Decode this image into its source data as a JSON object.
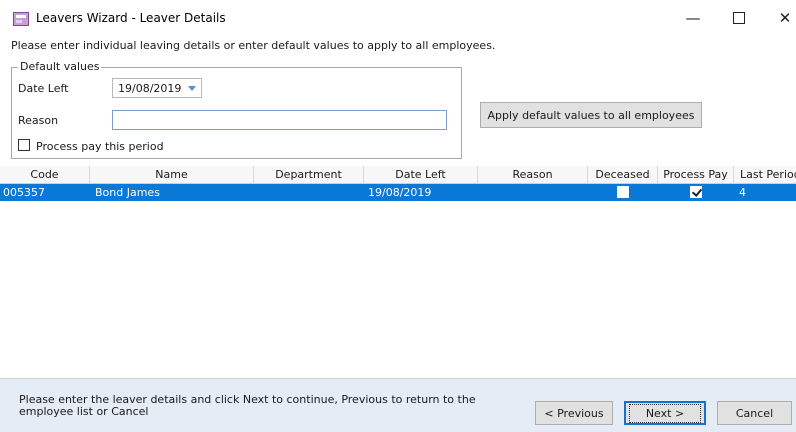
{
  "window": {
    "title": "Leavers Wizard - Leaver Details",
    "minimize": "—",
    "close": "✕"
  },
  "instructions": "Please enter individual leaving details or enter default values to apply to all employees.",
  "defaults": {
    "legend": "Default values",
    "date_left_label": "Date Left",
    "date_left_value": "19/08/2019",
    "reason_label": "Reason",
    "reason_value": "",
    "process_pay_label": "Process pay this period",
    "process_pay_checked": false,
    "apply_button": "Apply default values to all employees"
  },
  "grid": {
    "columns": [
      "Code",
      "Name",
      "Department",
      "Date Left",
      "Reason",
      "Deceased",
      "Process Pay",
      "Last Period"
    ],
    "rows": [
      {
        "code": "005357",
        "name": "Bond James",
        "department": "",
        "date_left": "19/08/2019",
        "reason": "",
        "deceased": false,
        "process_pay": true,
        "last_period": "4"
      }
    ]
  },
  "footer": {
    "message": "Please enter the leaver details and click Next to continue, Previous to return to the employee list or Cancel",
    "previous_button": "< Previous",
    "next_button": "Next >",
    "cancel_button": "Cancel"
  },
  "colors": {
    "selection": "#0a78d7",
    "footer_bg": "#e4ecf5"
  }
}
